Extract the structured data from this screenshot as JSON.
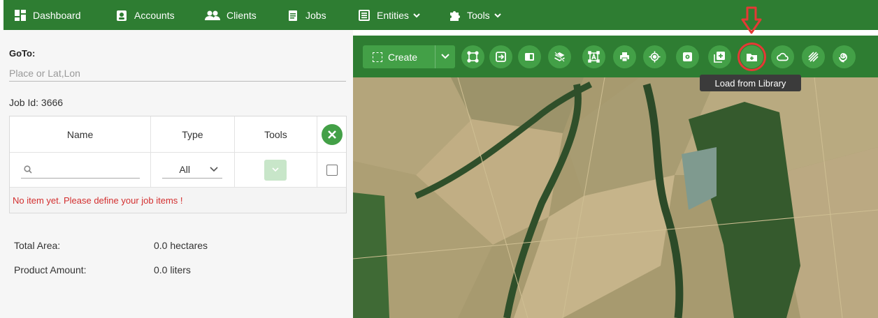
{
  "nav": {
    "items": [
      {
        "label": "Dashboard",
        "icon": "dashboard-icon"
      },
      {
        "label": "Accounts",
        "icon": "account-badge-icon"
      },
      {
        "label": "Clients",
        "icon": "users-icon"
      },
      {
        "label": "Jobs",
        "icon": "clipboard-icon"
      },
      {
        "label": "Entities",
        "icon": "list-icon",
        "has_dropdown": true
      },
      {
        "label": "Tools",
        "icon": "puzzle-icon",
        "has_dropdown": true
      }
    ]
  },
  "left_panel": {
    "goto_label": "GoTo:",
    "goto_placeholder": "Place or Lat,Lon",
    "job_id": "Job Id: 3666",
    "table": {
      "headers": [
        "Name",
        "Type",
        "Tools"
      ],
      "type_filter_value": "All",
      "empty_message": "No item yet. Please define your job items !"
    },
    "summary": [
      {
        "label": "Total Area:",
        "value": "0.0 hectares"
      },
      {
        "label": "Product Amount:",
        "value": "0.0 liters"
      }
    ]
  },
  "map": {
    "create_label": "Create",
    "tooltip": "Load from Library",
    "tool_icons": [
      "select-shape-icon",
      "import-icon",
      "layer-panel-icon",
      "layers-off-icon",
      "text-area-icon",
      "print-icon",
      "locate-icon",
      "settings-box-icon",
      "add-box-icon",
      "load-library-icon",
      "cloud-icon",
      "hatch-icon",
      "spiral-icon"
    ]
  },
  "colors": {
    "nav_bg": "#2e7d32",
    "button_green": "#43a047",
    "error_red": "#d32f2f",
    "highlight_red": "#e53935"
  }
}
